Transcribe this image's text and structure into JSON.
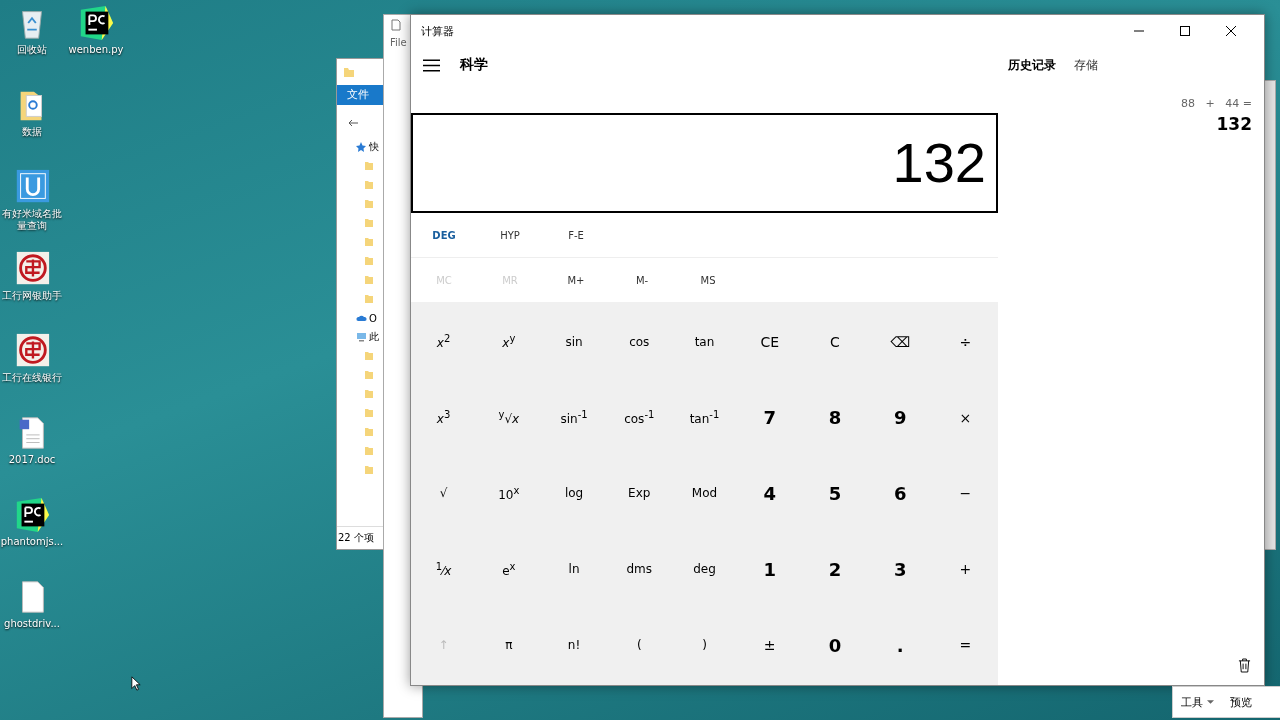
{
  "desktop_icons": [
    {
      "label": "回收站",
      "kind": "recycle"
    },
    {
      "label": "wenben.py",
      "kind": "pycharm"
    },
    {
      "label": "数据",
      "kind": "folder"
    },
    {
      "label": "有好米域名批量查询",
      "kind": "app"
    },
    {
      "label": "工行网银助手",
      "kind": "bank"
    },
    {
      "label": "工行在线银行",
      "kind": "bank"
    },
    {
      "label": "2017.doc",
      "kind": "doc"
    },
    {
      "label": "phantomjs...",
      "kind": "pycharm"
    },
    {
      "label": "ghostdriv...",
      "kind": "file"
    }
  ],
  "explorer": {
    "ribbon_tab": "文件",
    "nav_items": [
      {
        "label": "快",
        "kind": "star"
      },
      {
        "kind": "folder"
      },
      {
        "kind": "folder"
      },
      {
        "kind": "folder"
      },
      {
        "kind": "folder"
      },
      {
        "kind": "folder"
      },
      {
        "kind": "folder"
      },
      {
        "kind": "folder"
      },
      {
        "kind": "folder"
      },
      {
        "label": "O",
        "kind": "cloud"
      },
      {
        "label": "此",
        "kind": "pc"
      },
      {
        "kind": "folder"
      },
      {
        "kind": "folder"
      },
      {
        "kind": "folder"
      },
      {
        "kind": "folder"
      },
      {
        "kind": "folder"
      },
      {
        "kind": "folder"
      },
      {
        "kind": "folder"
      }
    ],
    "status": "22 个项"
  },
  "editor": {
    "menu": "File"
  },
  "calculator": {
    "title": "计算器",
    "mode": "科学",
    "display": "132",
    "angle_row": [
      {
        "label": "DEG",
        "highlighted": true
      },
      {
        "label": "HYP",
        "highlighted": false
      },
      {
        "label": "F-E",
        "highlighted": false
      }
    ],
    "memory_row": [
      {
        "label": "MC",
        "disabled": true
      },
      {
        "label": "MR",
        "disabled": true
      },
      {
        "label": "M+",
        "disabled": false
      },
      {
        "label": "M-",
        "disabled": false
      },
      {
        "label": "MS",
        "disabled": false
      }
    ],
    "keys": [
      {
        "label": "*x*$^{2}$",
        "kind": "fn",
        "disabled": false
      },
      {
        "label": "*x*$^{y}$",
        "kind": "fn",
        "disabled": false
      },
      {
        "label": "sin",
        "kind": "fn",
        "disabled": false
      },
      {
        "label": "cos",
        "kind": "fn",
        "disabled": false
      },
      {
        "label": "tan",
        "kind": "fn",
        "disabled": false
      },
      {
        "label": "CE",
        "kind": "op",
        "disabled": false
      },
      {
        "label": "C",
        "kind": "op",
        "disabled": false
      },
      {
        "label": "⌫",
        "kind": "op",
        "disabled": false
      },
      {
        "label": "÷",
        "kind": "op",
        "disabled": false
      },
      {
        "label": "*x*$^{3}$",
        "kind": "fn",
        "disabled": false
      },
      {
        "label": "$^{y}$√*x*",
        "kind": "fn",
        "disabled": false
      },
      {
        "label": "sin$^{-1}$",
        "kind": "fn",
        "disabled": false
      },
      {
        "label": "cos$^{-1}$",
        "kind": "fn",
        "disabled": false
      },
      {
        "label": "tan$^{-1}$",
        "kind": "fn",
        "disabled": false
      },
      {
        "label": "7",
        "kind": "digit",
        "disabled": false
      },
      {
        "label": "8",
        "kind": "digit",
        "disabled": false
      },
      {
        "label": "9",
        "kind": "digit",
        "disabled": false
      },
      {
        "label": "×",
        "kind": "op",
        "disabled": false
      },
      {
        "label": "√",
        "kind": "fn",
        "disabled": false
      },
      {
        "label": "10$^{x}$",
        "kind": "fn",
        "disabled": false
      },
      {
        "label": "log",
        "kind": "fn",
        "disabled": false
      },
      {
        "label": "Exp",
        "kind": "fn",
        "disabled": false
      },
      {
        "label": "Mod",
        "kind": "fn",
        "disabled": false
      },
      {
        "label": "4",
        "kind": "digit",
        "disabled": false
      },
      {
        "label": "5",
        "kind": "digit",
        "disabled": false
      },
      {
        "label": "6",
        "kind": "digit",
        "disabled": false
      },
      {
        "label": "−",
        "kind": "op",
        "disabled": false
      },
      {
        "label": "$^{1}$⁄*x*",
        "kind": "fn",
        "disabled": false
      },
      {
        "label": "e$^{x}$",
        "kind": "fn",
        "disabled": false
      },
      {
        "label": "ln",
        "kind": "fn",
        "disabled": false
      },
      {
        "label": "dms",
        "kind": "fn",
        "disabled": false
      },
      {
        "label": "deg",
        "kind": "fn",
        "disabled": false
      },
      {
        "label": "1",
        "kind": "digit",
        "disabled": false
      },
      {
        "label": "2",
        "kind": "digit",
        "disabled": false
      },
      {
        "label": "3",
        "kind": "digit",
        "disabled": false
      },
      {
        "label": "+",
        "kind": "op",
        "disabled": false
      },
      {
        "label": "↑",
        "kind": "fn",
        "disabled": true
      },
      {
        "label": "π",
        "kind": "fn",
        "disabled": false
      },
      {
        "label": "n!",
        "kind": "fn",
        "disabled": false
      },
      {
        "label": "(",
        "kind": "fn",
        "disabled": false
      },
      {
        "label": ")",
        "kind": "fn",
        "disabled": false
      },
      {
        "label": "±",
        "kind": "op",
        "disabled": false
      },
      {
        "label": "0",
        "kind": "digit",
        "disabled": false
      },
      {
        "label": ".",
        "kind": "digit",
        "disabled": false
      },
      {
        "label": "=",
        "kind": "op",
        "disabled": false
      }
    ],
    "side_tabs": [
      {
        "label": "历史记录",
        "selected": true
      },
      {
        "label": "存储",
        "selected": false
      }
    ],
    "history": [
      {
        "expression": "88   +   44 =",
        "result": "132"
      }
    ]
  },
  "bottom_toolbar": {
    "tools": "工具",
    "preview": "预览"
  }
}
